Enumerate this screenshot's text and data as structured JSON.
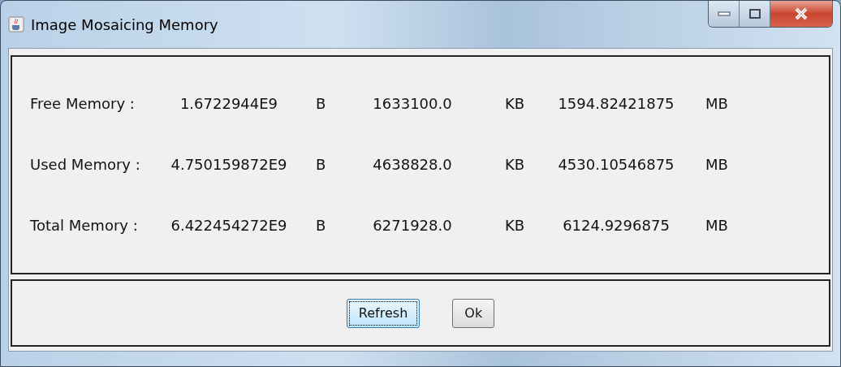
{
  "window": {
    "title": "Image Mosaicing Memory"
  },
  "rows": [
    {
      "label": "Free Memory :",
      "bytes": "1.6722944E9",
      "bytes_unit": "B",
      "kb": "1633100.0",
      "kb_unit": "KB",
      "mb": "1594.82421875",
      "mb_unit": "MB"
    },
    {
      "label": "Used Memory :",
      "bytes": "4.750159872E9",
      "bytes_unit": "B",
      "kb": "4638828.0",
      "kb_unit": "KB",
      "mb": "4530.10546875",
      "mb_unit": "MB"
    },
    {
      "label": "Total Memory :",
      "bytes": "6.422454272E9",
      "bytes_unit": "B",
      "kb": "6271928.0",
      "kb_unit": "KB",
      "mb": "6124.9296875",
      "mb_unit": "MB"
    }
  ],
  "buttons": [
    {
      "label": "Refresh",
      "focused": true
    },
    {
      "label": "Ok",
      "focused": false
    }
  ]
}
